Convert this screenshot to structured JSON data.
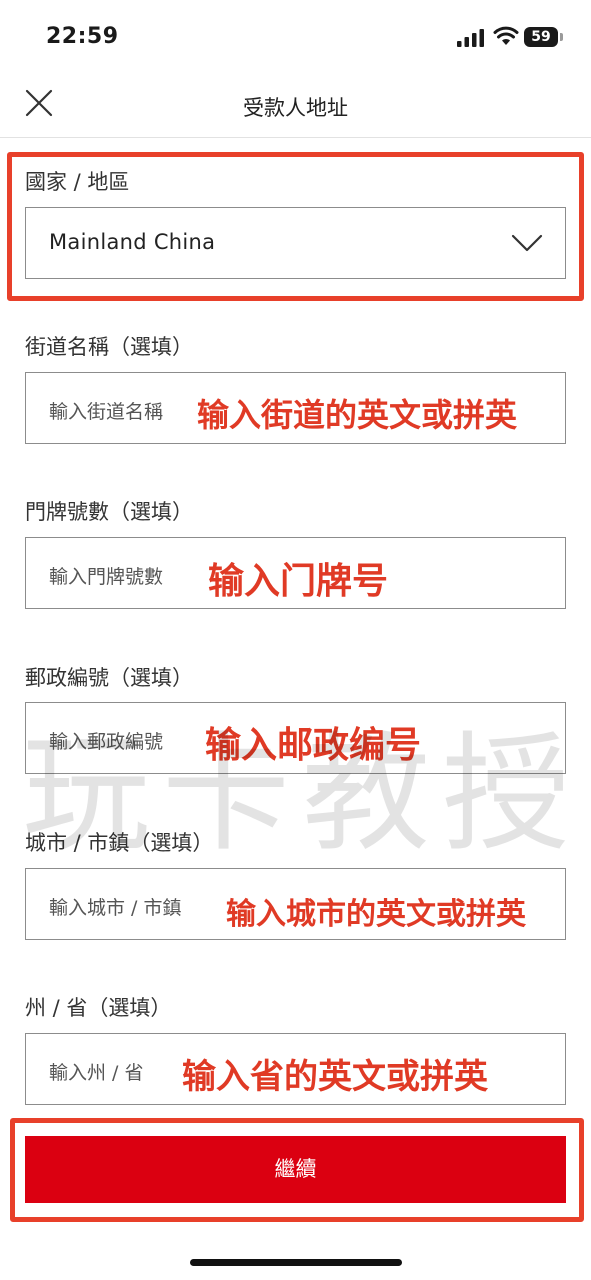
{
  "status_bar": {
    "time": "22:59",
    "battery_level": "59",
    "icons": [
      "signal-icon",
      "wifi-icon",
      "battery-icon"
    ]
  },
  "nav": {
    "title": "受款人地址",
    "close_icon": "close-icon"
  },
  "form": {
    "country": {
      "label": "國家 / 地區",
      "value": "Mainland China",
      "icon": "chevron-down-icon"
    },
    "street": {
      "label": "街道名稱（選填）",
      "placeholder": "輸入街道名稱"
    },
    "house_number": {
      "label": "門牌號數（選填）",
      "placeholder": "輸入門牌號數"
    },
    "postal_code": {
      "label": "郵政編號（選填）",
      "placeholder": "輸入郵政編號"
    },
    "city": {
      "label": "城市 / 市鎮（選填）",
      "placeholder": "輸入城市 / 市鎮"
    },
    "state": {
      "label": "州 / 省（選填）",
      "placeholder": "輸入州 / 省"
    }
  },
  "annotations": {
    "street": "输入街道的英文或拼英",
    "house_number": "输入门牌号",
    "postal_code": "输入邮政编号",
    "city": "输入城市的英文或拼英",
    "state": "输入省的英文或拼英"
  },
  "watermark": "玩卡教授",
  "continue_button": "繼續",
  "colors": {
    "brand_red": "#db0011",
    "annotation_red": "#e03a25",
    "highlight_border": "#e8402a"
  }
}
